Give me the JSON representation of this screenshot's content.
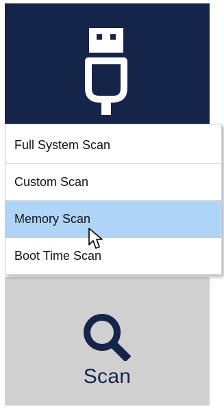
{
  "colors": {
    "navy": "#15254a",
    "tile_grey": "#d0d0d0",
    "highlight": "#aed5f5"
  },
  "usb_tile": {
    "icon": "usb-icon"
  },
  "menu": {
    "items": [
      {
        "label": "Full System Scan",
        "highlighted": false
      },
      {
        "label": "Custom Scan",
        "highlighted": false
      },
      {
        "label": "Memory Scan",
        "highlighted": true
      },
      {
        "label": "Boot Time Scan",
        "highlighted": false
      }
    ]
  },
  "scan_tile": {
    "icon": "search-icon",
    "label": "Scan"
  },
  "cursor": {
    "icon": "arrow-cursor-icon"
  }
}
